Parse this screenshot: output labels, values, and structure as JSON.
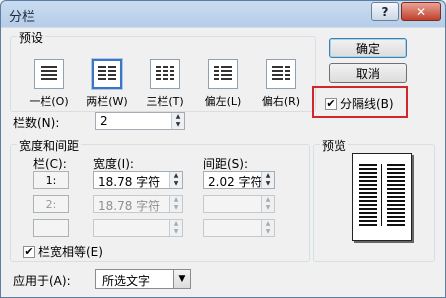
{
  "window": {
    "title": "分栏",
    "help_label": "?",
    "close_label": "✕"
  },
  "presets": {
    "group_label": "预设",
    "items": [
      {
        "label": "一栏(O)",
        "cols": 1
      },
      {
        "label": "两栏(W)",
        "cols": 2
      },
      {
        "label": "三栏(T)",
        "cols": 3
      },
      {
        "label": "偏左(L)",
        "cols": "left"
      },
      {
        "label": "偏右(R)",
        "cols": "right"
      }
    ],
    "selected": "两栏(W)"
  },
  "buttons": {
    "ok": "确定",
    "cancel": "取消"
  },
  "separator": {
    "label": "分隔线(B)",
    "checked": true
  },
  "column_count": {
    "label": "栏数(N):",
    "value": "2"
  },
  "width_spacing": {
    "group_label": "宽度和间距",
    "headers": {
      "col": "栏(C):",
      "width": "宽度(I):",
      "spacing": "间距(S):"
    },
    "rows": [
      {
        "col": "1:",
        "width": "18.78 字符",
        "spacing": "2.02 字符",
        "enabled": true
      },
      {
        "col": "2:",
        "width": "18.78 字符",
        "spacing": "",
        "enabled": false
      },
      {
        "col": "",
        "width": "",
        "spacing": "",
        "enabled": false
      }
    ],
    "equal_width": {
      "label": "栏宽相等(E)",
      "checked": true
    }
  },
  "preview": {
    "label": "预览"
  },
  "apply_to": {
    "label": "应用于(A):",
    "value": "所选文字"
  },
  "colors": {
    "highlight": "#d3252b",
    "selected_border": "#3a76c4"
  }
}
